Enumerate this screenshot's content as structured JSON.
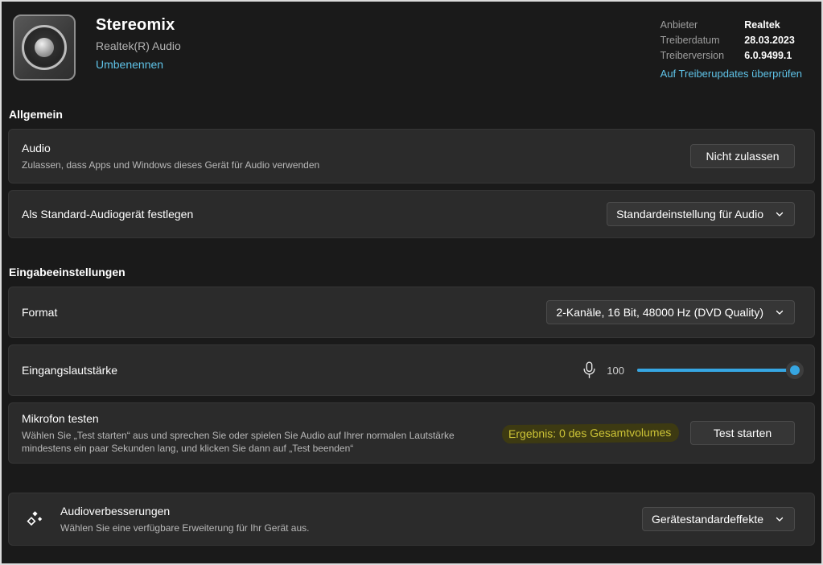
{
  "header": {
    "device_name": "Stereomix",
    "device_subtitle": "Realtek(R) Audio",
    "rename_link": "Umbenennen",
    "driver_info": [
      {
        "label": "Anbieter",
        "value": "Realtek"
      },
      {
        "label": "Treiberdatum",
        "value": "28.03.2023"
      },
      {
        "label": "Treiberversion",
        "value": "6.0.9499.1"
      }
    ],
    "update_link": "Auf Treiberupdates überprüfen"
  },
  "sections": {
    "general": {
      "title": "Allgemein",
      "audio_row": {
        "title": "Audio",
        "description": "Zulassen, dass Apps und Windows dieses Gerät für Audio verwenden",
        "button_label": "Nicht zulassen"
      },
      "default_device_row": {
        "title": "Als Standard-Audiogerät festlegen",
        "dropdown_value": "Standardeinstellung für Audio"
      }
    },
    "input": {
      "title": "Eingabeeinstellungen",
      "format_row": {
        "title": "Format",
        "dropdown_value": "2-Kanäle, 16 Bit, 48000 Hz (DVD Quality)"
      },
      "volume_row": {
        "title": "Eingangslautstärke",
        "value": "100",
        "slider_percent": 100
      },
      "mic_test_row": {
        "title": "Mikrofon testen",
        "description": "Wählen Sie „Test starten“ aus und sprechen Sie oder spielen Sie Audio auf Ihrer normalen Lautstärke mindestens ein paar Sekunden lang, und klicken Sie dann auf „Test beenden“",
        "result_text": "Ergebnis: 0 des Gesamtvolumes",
        "button_label": "Test starten"
      }
    },
    "enhancements_row": {
      "title": "Audioverbesserungen",
      "description": "Wählen Sie eine verfügbare Erweiterung für Ihr Gerät aus.",
      "dropdown_value": "Gerätestandardeffekte"
    }
  },
  "colors": {
    "accent_blue": "#36a6e2",
    "link_blue": "#5fc3e8",
    "highlight_text": "#cbc236",
    "highlight_bg": "#3d3a12",
    "card_bg": "#2b2b2b",
    "page_bg": "#1a1a1a"
  }
}
